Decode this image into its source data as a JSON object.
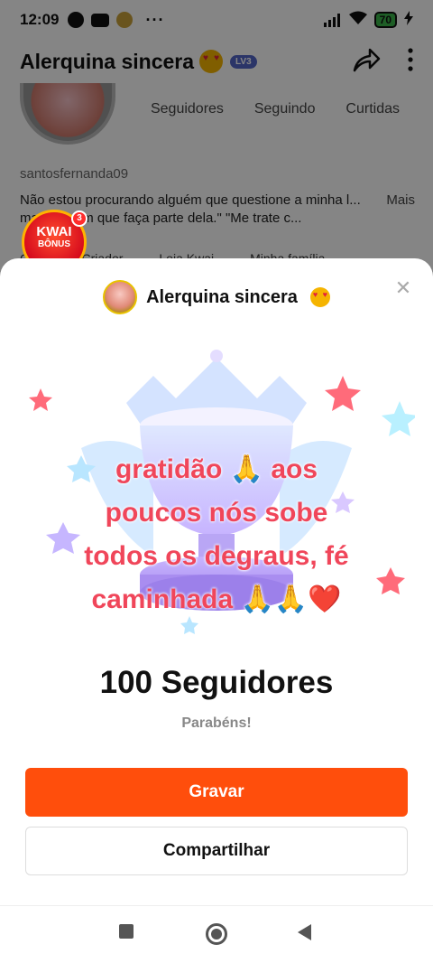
{
  "status_bar": {
    "time": "12:09",
    "battery": "70"
  },
  "profile": {
    "title": "Alerquina sincera",
    "level_badge": "LV3",
    "stats": [
      {
        "label": "Seguidores"
      },
      {
        "label": "Seguindo"
      },
      {
        "label": "Curtidas"
      }
    ],
    "username": "santosfernanda09",
    "bio": "Não estou procurando alguém que questione a minha l... mas alguém que faça parte dela.\" \"Me trate c...",
    "bio_more": "Mais",
    "links": [
      "Central do Criador",
      "Loja Kwai",
      "Minha família"
    ]
  },
  "kwai_bonus": {
    "line1": "KWAI",
    "line2": "BÔNUS",
    "badge_count": "3"
  },
  "sheet": {
    "name": "Alerquina sincera",
    "message_lines": [
      "gratidão 🙏 aos",
      "poucos nós sobe",
      "todos os degraus, fé",
      "caminhada 🙏🙏❤️"
    ],
    "milestone": "100 Seguidores",
    "congrats": "Parabéns!",
    "record_label": "Gravar",
    "share_label": "Compartilhar"
  },
  "colors": {
    "accent": "#ff4e0c",
    "message_text": "#f0465a",
    "level_badge": "#5467c7"
  }
}
